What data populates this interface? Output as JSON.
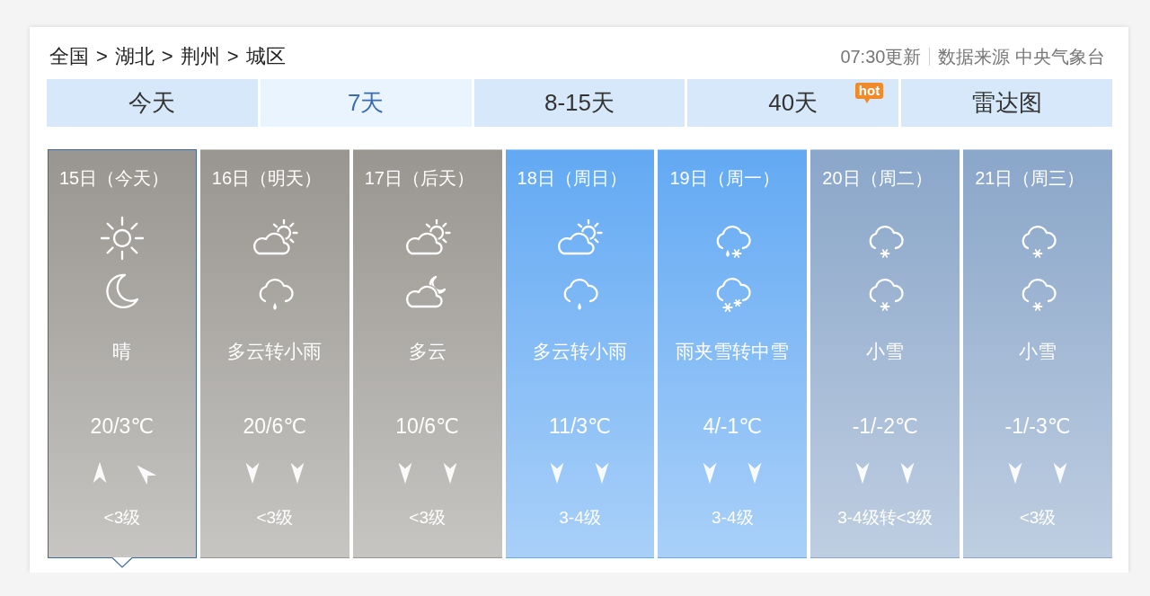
{
  "breadcrumb": {
    "items": [
      "全国",
      "湖北",
      "荆州",
      "城区"
    ],
    "separator": ">"
  },
  "update_time": "07:30更新",
  "data_source": "数据来源 中央气象台",
  "tabs": [
    {
      "label": "今天",
      "selected": false
    },
    {
      "label": "7天",
      "selected": true
    },
    {
      "label": "8-15天",
      "selected": false
    },
    {
      "label": "40天",
      "selected": false,
      "badge": "hot"
    },
    {
      "label": "雷达图",
      "selected": false
    }
  ],
  "days": [
    {
      "date": "15日（今天）",
      "selected": true,
      "color": "#999691",
      "icons": [
        {
          "kind": "sunny"
        },
        {
          "kind": "clear"
        }
      ],
      "weather": "晴",
      "temperature": "20/3℃",
      "wind_arrows": [
        {
          "kind": "up"
        },
        {
          "kind": "up-left"
        }
      ],
      "wind": "<3级"
    },
    {
      "date": "16日（明天）",
      "selected": false,
      "color": "#999691",
      "icons": [
        {
          "kind": "partly-cloudy"
        },
        {
          "kind": "light-rain"
        }
      ],
      "weather": "多云转小雨",
      "temperature": "20/6℃",
      "wind_arrows": [
        {
          "kind": "down"
        },
        {
          "kind": "down"
        }
      ],
      "wind": "<3级"
    },
    {
      "date": "17日（后天）",
      "selected": false,
      "color": "#999691",
      "icons": [
        {
          "kind": "partly-cloudy"
        },
        {
          "kind": "partly-cloudy-night"
        }
      ],
      "weather": "多云",
      "temperature": "10/6℃",
      "wind_arrows": [
        {
          "kind": "down"
        },
        {
          "kind": "down"
        }
      ],
      "wind": "<3级"
    },
    {
      "date": "18日（周日）",
      "selected": false,
      "color": "#62a9f3",
      "icons": [
        {
          "kind": "partly-cloudy"
        },
        {
          "kind": "light-rain"
        }
      ],
      "weather": "多云转小雨",
      "temperature": "11/3℃",
      "wind_arrows": [
        {
          "kind": "down"
        },
        {
          "kind": "down"
        }
      ],
      "wind": "3-4级"
    },
    {
      "date": "19日（周一）",
      "selected": false,
      "color": "#62a9f3",
      "icons": [
        {
          "kind": "sleet"
        },
        {
          "kind": "moderate-snow"
        }
      ],
      "weather": "雨夹雪转中雪",
      "temperature": "4/-1℃",
      "wind_arrows": [
        {
          "kind": "down"
        },
        {
          "kind": "down"
        }
      ],
      "wind": "3-4级"
    },
    {
      "date": "20日（周二）",
      "selected": false,
      "color": "#8aa6c9",
      "icons": [
        {
          "kind": "light-snow"
        },
        {
          "kind": "light-snow"
        }
      ],
      "weather": "小雪",
      "temperature": "-1/-2℃",
      "wind_arrows": [
        {
          "kind": "down"
        },
        {
          "kind": "down"
        }
      ],
      "wind": "3-4级转<3级"
    },
    {
      "date": "21日（周三）",
      "selected": false,
      "color": "#8aa6c9",
      "icons": [
        {
          "kind": "light-snow"
        },
        {
          "kind": "light-snow"
        }
      ],
      "weather": "小雪",
      "temperature": "-1/-3℃",
      "wind_arrows": [
        {
          "kind": "down"
        },
        {
          "kind": "down"
        }
      ],
      "wind": "<3级"
    }
  ]
}
